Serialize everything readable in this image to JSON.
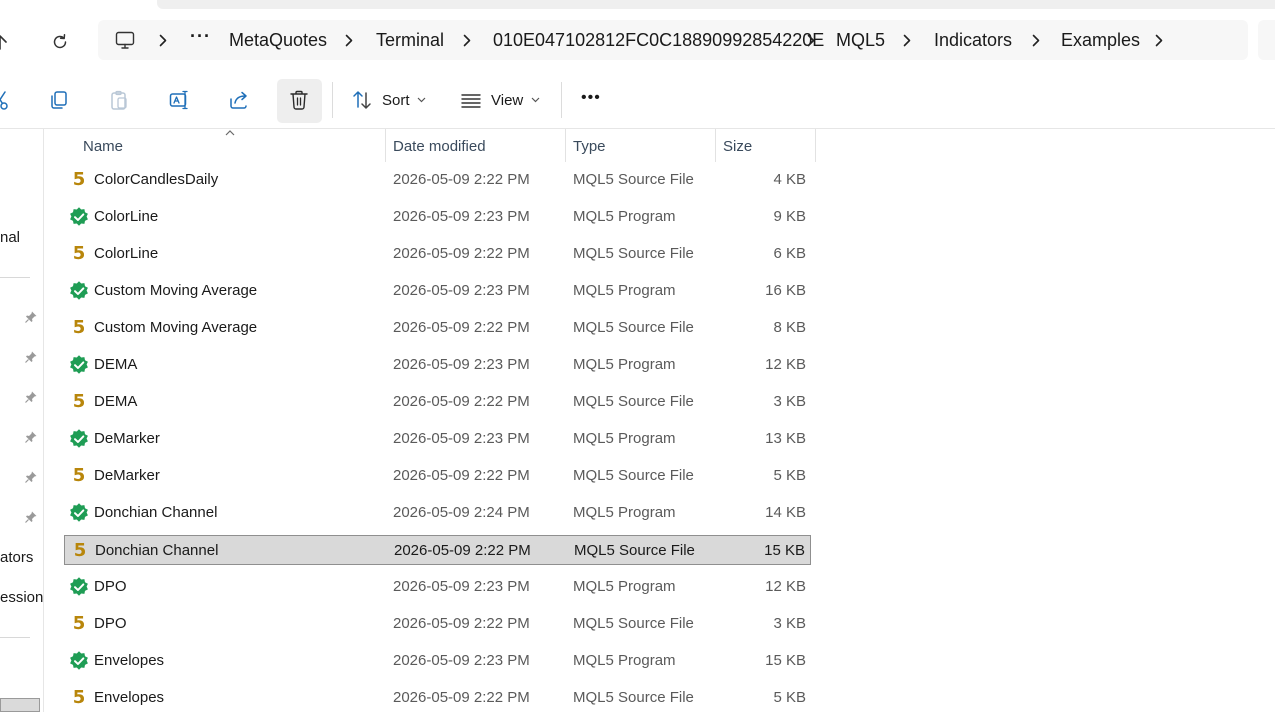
{
  "breadcrumb": {
    "computer_icon": "computer-icon",
    "overflow": "···",
    "items": [
      "MetaQuotes",
      "Terminal",
      "010E047102812FC0C18890992854220E",
      "MQL5",
      "Indicators",
      "Examples"
    ]
  },
  "toolbar": {
    "sort_label": "Sort",
    "view_label": "View",
    "more_label": "•••"
  },
  "nav_pane": {
    "items": [
      "nal",
      "ators",
      "ession"
    ]
  },
  "columns": {
    "name": "Name",
    "date": "Date modified",
    "type": "Type",
    "size": "Size"
  },
  "files": [
    {
      "name": "ColorCandlesDaily",
      "date": "2026-05-09 2:22 PM",
      "type": "MQL5 Source File",
      "size": "4 KB",
      "icon": "mql5-source-icon"
    },
    {
      "name": "ColorLine",
      "date": "2026-05-09 2:23 PM",
      "type": "MQL5 Program",
      "size": "9 KB",
      "icon": "mql5-program-icon"
    },
    {
      "name": "ColorLine",
      "date": "2026-05-09 2:22 PM",
      "type": "MQL5 Source File",
      "size": "6 KB",
      "icon": "mql5-source-icon"
    },
    {
      "name": "Custom Moving Average",
      "date": "2026-05-09 2:23 PM",
      "type": "MQL5 Program",
      "size": "16 KB",
      "icon": "mql5-program-icon"
    },
    {
      "name": "Custom Moving Average",
      "date": "2026-05-09 2:22 PM",
      "type": "MQL5 Source File",
      "size": "8 KB",
      "icon": "mql5-source-icon"
    },
    {
      "name": "DEMA",
      "date": "2026-05-09 2:23 PM",
      "type": "MQL5 Program",
      "size": "12 KB",
      "icon": "mql5-program-icon"
    },
    {
      "name": "DEMA",
      "date": "2026-05-09 2:22 PM",
      "type": "MQL5 Source File",
      "size": "3 KB",
      "icon": "mql5-source-icon"
    },
    {
      "name": "DeMarker",
      "date": "2026-05-09 2:23 PM",
      "type": "MQL5 Program",
      "size": "13 KB",
      "icon": "mql5-program-icon"
    },
    {
      "name": "DeMarker",
      "date": "2026-05-09 2:22 PM",
      "type": "MQL5 Source File",
      "size": "5 KB",
      "icon": "mql5-source-icon"
    },
    {
      "name": "Donchian Channel",
      "date": "2026-05-09 2:24 PM",
      "type": "MQL5 Program",
      "size": "14 KB",
      "icon": "mql5-program-icon"
    },
    {
      "name": "Donchian Channel",
      "date": "2026-05-09 2:22 PM",
      "type": "MQL5 Source File",
      "size": "15 KB",
      "icon": "mql5-source-icon",
      "selected": true
    },
    {
      "name": "DPO",
      "date": "2026-05-09 2:23 PM",
      "type": "MQL5 Program",
      "size": "12 KB",
      "icon": "mql5-program-icon"
    },
    {
      "name": "DPO",
      "date": "2026-05-09 2:22 PM",
      "type": "MQL5 Source File",
      "size": "3 KB",
      "icon": "mql5-source-icon"
    },
    {
      "name": "Envelopes",
      "date": "2026-05-09 2:23 PM",
      "type": "MQL5 Program",
      "size": "15 KB",
      "icon": "mql5-program-icon"
    },
    {
      "name": "Envelopes",
      "date": "2026-05-09 2:22 PM",
      "type": "MQL5 Source File",
      "size": "5 KB",
      "icon": "mql5-source-icon"
    }
  ],
  "colors": {
    "program_icon": "#1f9d55",
    "source_icon": "#b8860b",
    "selection_bg": "#d9d9d9"
  }
}
